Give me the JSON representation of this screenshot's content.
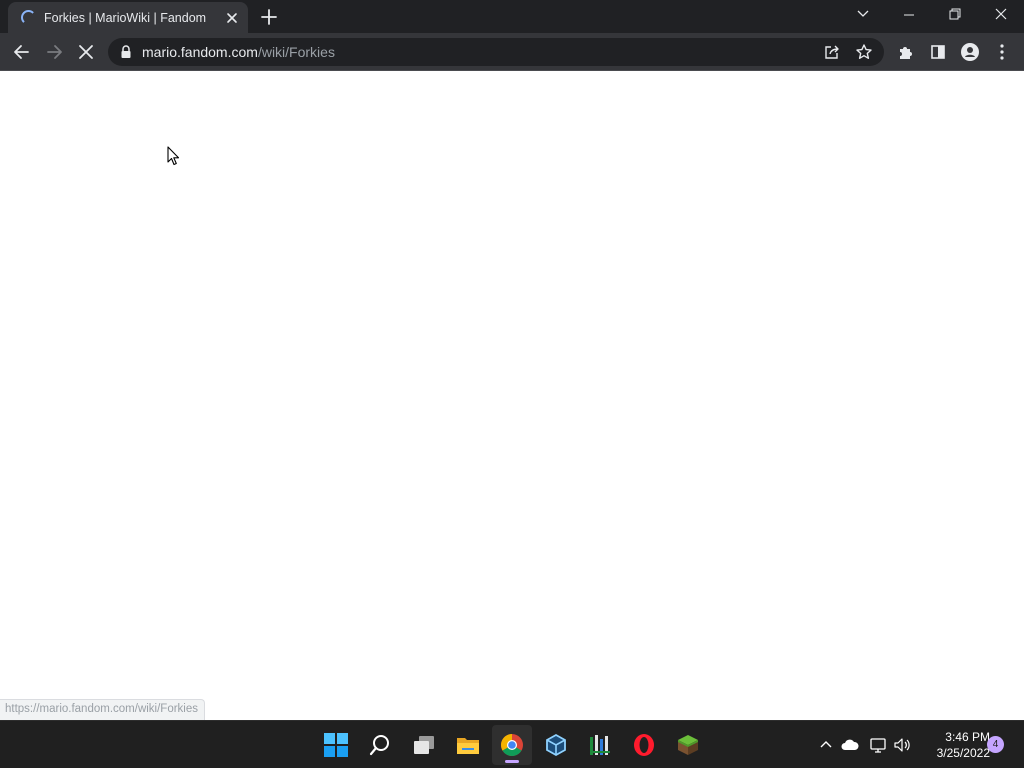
{
  "browser": {
    "tab": {
      "title": "Forkies | MarioWiki | Fandom"
    },
    "address": {
      "host": "mario.fandom.com",
      "path": "/wiki/Forkies"
    },
    "status_url": "https://mario.fandom.com/wiki/Forkies"
  },
  "taskbar": {
    "apps": [
      "start-icon",
      "search-icon",
      "task-view-icon",
      "file-explorer-icon",
      "chrome-icon",
      "virtualbox-icon",
      "app-icon",
      "opera-icon",
      "minecraft-icon"
    ],
    "clock": {
      "time": "3:46 PM",
      "date": "3/25/2022"
    },
    "notification_count": "4"
  },
  "colors": {
    "tab_strip": "#202124",
    "toolbar": "#35363a",
    "omnibox": "#202124",
    "taskbar": "#202020",
    "accent": "#c5a5ff"
  }
}
